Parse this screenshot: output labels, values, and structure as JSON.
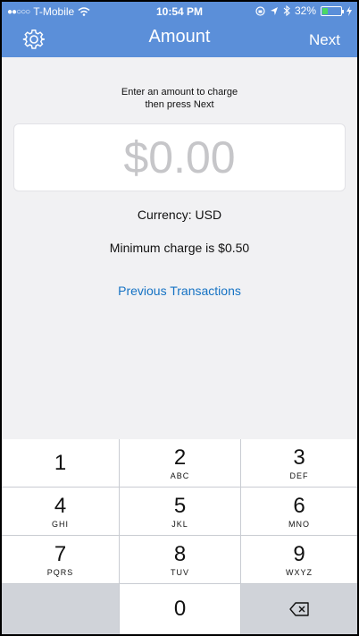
{
  "status_bar": {
    "signal": "●●○○○",
    "carrier": "T-Mobile",
    "time": "10:54 PM",
    "battery_percent": "32%",
    "battery_level": 0.32
  },
  "nav": {
    "title": "Amount",
    "next_label": "Next",
    "settings_icon": "gear-icon"
  },
  "prompt": {
    "line1": "Enter an amount to charge",
    "line2": "then press Next"
  },
  "amount": {
    "placeholder": "$0.00"
  },
  "currency_text": "Currency: USD",
  "minimum_text": "Minimum charge is $0.50",
  "previous_transactions_label": "Previous Transactions",
  "keypad": [
    {
      "num": "1",
      "letters": ""
    },
    {
      "num": "2",
      "letters": "ABC"
    },
    {
      "num": "3",
      "letters": "DEF"
    },
    {
      "num": "4",
      "letters": "GHI"
    },
    {
      "num": "5",
      "letters": "JKL"
    },
    {
      "num": "6",
      "letters": "MNO"
    },
    {
      "num": "7",
      "letters": "PQRS"
    },
    {
      "num": "8",
      "letters": "TUV"
    },
    {
      "num": "9",
      "letters": "WXYZ"
    },
    {
      "num": "0",
      "letters": ""
    }
  ],
  "colors": {
    "header": "#5b8fd9",
    "link": "#1673c4",
    "battery": "#4cd964"
  }
}
